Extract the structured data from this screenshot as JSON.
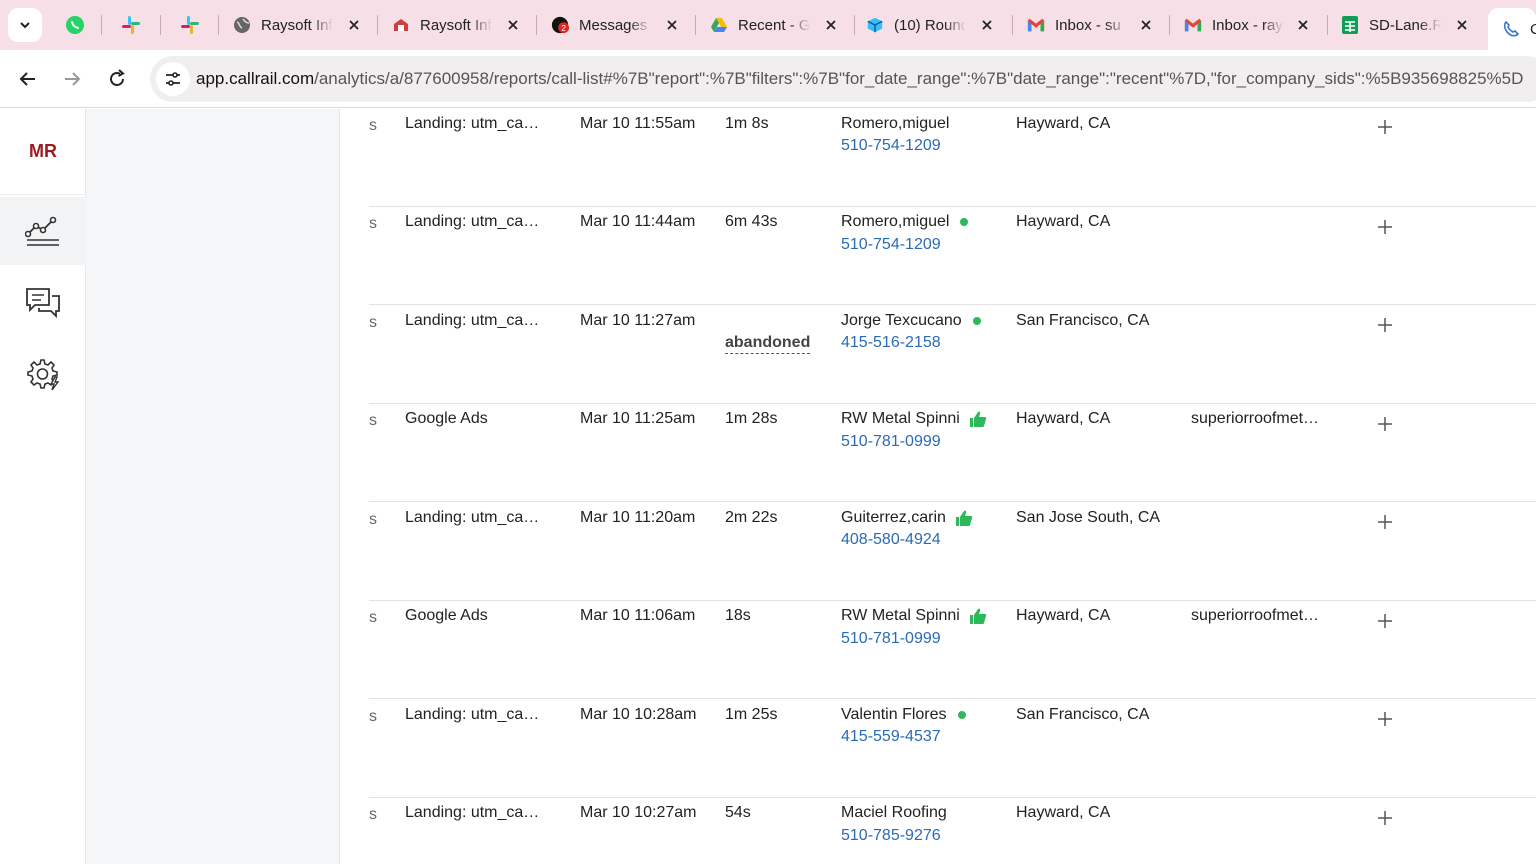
{
  "browser": {
    "tabs": [
      {
        "label": "Raysoft Inf",
        "icon": "globe-icon"
      },
      {
        "label": "Raysoft Inf",
        "icon": "raysoft-icon"
      },
      {
        "label": "Messages",
        "icon": "messages-icon"
      },
      {
        "label": "Recent - G",
        "icon": "google-drive-icon"
      },
      {
        "label": "(10) Round",
        "icon": "roundcube-icon"
      },
      {
        "label": "Inbox - su",
        "icon": "gmail-icon"
      },
      {
        "label": "Inbox - ray",
        "icon": "gmail-icon"
      },
      {
        "label": "SD-Lane.R",
        "icon": "google-sheets-icon"
      },
      {
        "label": "C",
        "icon": "callrail-icon"
      }
    ],
    "url_host": "app.callrail.com",
    "url_path": "/analytics/a/877600958/reports/call-list#%7B\"report\":%7B\"filters\":%7B\"for_date_range\":%7B\"date_range\":\"recent\"%7D,\"for_company_sids\":%5B935698825%5D"
  },
  "rail": {
    "avatar_initials": "MR"
  },
  "colors": {
    "accent_link": "#2a6bb5",
    "status_green": "#2eb85c",
    "avatar_red": "#9a1b1f",
    "tabstrip_pink": "#f6dfe6"
  },
  "rows": [
    {
      "source": "Landing: utm_ca…",
      "time": "Mar 10 11:55am",
      "duration": "1m 8s",
      "name": "Romero,miguel",
      "indicator": "none",
      "phone": "510-754-1209",
      "location": "Hayward, CA",
      "website": ""
    },
    {
      "source": "Landing: utm_ca…",
      "time": "Mar 10 11:44am",
      "duration": "6m 43s",
      "name": "Romero,miguel",
      "indicator": "dot",
      "phone": "510-754-1209",
      "location": "Hayward, CA",
      "website": ""
    },
    {
      "source": "Landing: utm_ca…",
      "time": "Mar 10 11:27am",
      "duration": "",
      "status": "abandoned",
      "name": "Jorge Texcucano",
      "indicator": "dot",
      "phone": "415-516-2158",
      "location": "San Francisco, CA",
      "website": ""
    },
    {
      "source": "Google Ads",
      "time": "Mar 10 11:25am",
      "duration": "1m 28s",
      "name": "RW Metal Spinni",
      "indicator": "thumb",
      "phone": "510-781-0999",
      "location": "Hayward, CA",
      "website": "superiorroofmet…"
    },
    {
      "source": "Landing: utm_ca…",
      "time": "Mar 10 11:20am",
      "duration": "2m 22s",
      "name": "Guiterrez,carin",
      "indicator": "thumb",
      "phone": "408-580-4924",
      "location": "San Jose South, CA",
      "website": ""
    },
    {
      "source": "Google Ads",
      "time": "Mar 10 11:06am",
      "duration": "18s",
      "name": "RW Metal Spinni",
      "indicator": "thumb",
      "phone": "510-781-0999",
      "location": "Hayward, CA",
      "website": "superiorroofmet…"
    },
    {
      "source": "Landing: utm_ca…",
      "time": "Mar 10 10:28am",
      "duration": "1m 25s",
      "name": "Valentin Flores",
      "indicator": "dot",
      "phone": "415-559-4537",
      "location": "San Francisco, CA",
      "website": ""
    },
    {
      "source": "Landing: utm_ca…",
      "time": "Mar 10 10:27am",
      "duration": "54s",
      "name": "Maciel Roofing",
      "indicator": "none",
      "phone": "510-785-9276",
      "location": "Hayward, CA",
      "website": ""
    }
  ]
}
